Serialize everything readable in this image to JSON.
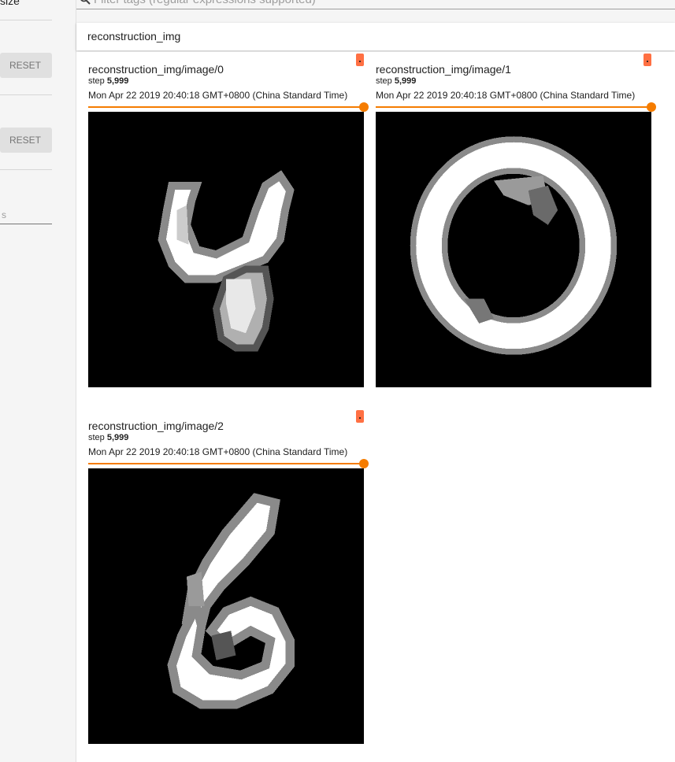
{
  "sidebar": {
    "top_label": "size",
    "reset_1": "RESET",
    "reset_2": "RESET",
    "input_tail": "s"
  },
  "search": {
    "placeholder": "Filter tags (regular expressions supported)"
  },
  "category": {
    "title": "reconstruction_img"
  },
  "cards": [
    {
      "title": "reconstruction_img/image/0",
      "step_label": "step",
      "step_value": "5,999",
      "timestamp": "Mon Apr 22 2019 20:40:18 GMT+0800 (China Standard Time)",
      "digit": "4"
    },
    {
      "title": "reconstruction_img/image/1",
      "step_label": "step",
      "step_value": "5,999",
      "timestamp": "Mon Apr 22 2019 20:40:18 GMT+0800 (China Standard Time)",
      "digit": "0"
    },
    {
      "title": "reconstruction_img/image/2",
      "step_label": "step",
      "step_value": "5,999",
      "timestamp": "Mon Apr 22 2019 20:40:18 GMT+0800 (China Standard Time)",
      "digit": "6"
    }
  ],
  "colors": {
    "accent": "#f57c00",
    "expand_button": "#ff7043",
    "image_background": "#000000"
  },
  "icons": [
    "search-icon",
    "expand-icon"
  ]
}
